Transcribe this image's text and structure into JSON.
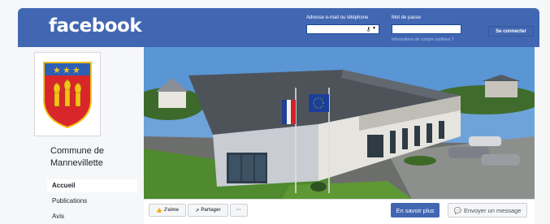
{
  "header": {
    "brand": "facebook",
    "email_label": "Adresse e-mail ou téléphone",
    "password_label": "Mot de passe",
    "forgot_link": "Informations de compte oubliées ?",
    "login_button": "Se connecter",
    "bg_color": "#4267b2"
  },
  "page": {
    "name": "Commune de Mannevillette"
  },
  "nav": {
    "items": [
      {
        "label": "Accueil",
        "active": true
      },
      {
        "label": "Publications",
        "active": false
      },
      {
        "label": "Avis",
        "active": false
      }
    ]
  },
  "actions": {
    "like": "J'aime",
    "share": "Partager",
    "more": "···",
    "learn_more": "En savoir plus",
    "message": "Envoyer un message"
  },
  "icons": [
    "thumbs-up-icon",
    "share-icon",
    "messenger-icon",
    "key-icon",
    "chevron-down-icon"
  ],
  "colors": {
    "accent": "#4267b2",
    "active_nav": "#ffffff"
  }
}
